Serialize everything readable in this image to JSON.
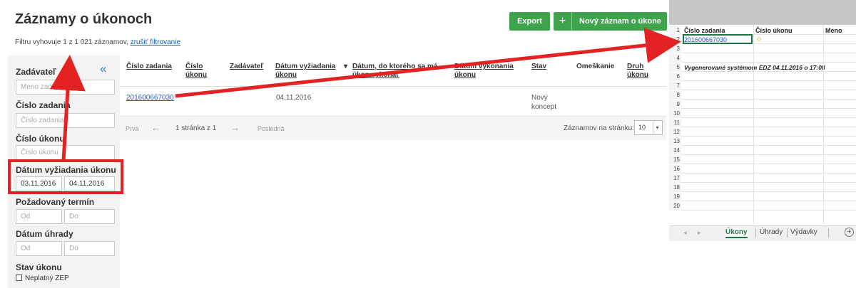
{
  "page": {
    "title": "Záznamy o úkonoch",
    "filter_prefix": "Filtru vyhovuje 1 z 1 021 záznamov, ",
    "filter_clear": "zrušiť filtrovanie"
  },
  "toolbar": {
    "export_label": "Export",
    "new_icon": "+",
    "new_label": "Nový záznam o úkone"
  },
  "sidebar": {
    "collapse_icon": "«",
    "zadavatel": {
      "label": "Zadávateľ",
      "placeholder": "Meno zadávateľa"
    },
    "cislo_zadania": {
      "label": "Číslo zadania",
      "placeholder": "Číslo zadania"
    },
    "cislo_ukonu": {
      "label": "Číslo úkonu",
      "placeholder": "Číslo úkonu"
    },
    "datum_vyziadania": {
      "label": "Dátum vyžiadania úkonu",
      "from": "03.11.2016",
      "to": "04.11.2016"
    },
    "pozadovany_termin": {
      "label": "Požadovaný termín",
      "from_placeholder": "Od",
      "to_placeholder": "Do"
    },
    "datum_uhrady": {
      "label": "Dátum úhrady",
      "from_placeholder": "Od",
      "to_placeholder": "Do"
    },
    "stav_ukonu": {
      "label": "Stav úkonu",
      "option": "Neplatný ZEP"
    }
  },
  "table": {
    "headers": {
      "cislo_zadania": "Číslo zadania",
      "cislo_ukonu_1": "Číslo",
      "cislo_ukonu_2": "úkonu",
      "zadavatel": "Zadávateľ",
      "datum_vyziadania_1": "Dátum vyžiadania",
      "datum_vyziadania_2": "úkonu",
      "sort_icon": "▾",
      "datum_do_1": "Dátum, do ktorého sa má",
      "datum_do_2": "úkon vykonať",
      "datum_vykonania_1": "Dátum vykonania",
      "datum_vykonania_2": "úkonu",
      "stav": "Stav",
      "omeskanie": "Omeškanie",
      "druh_1": "Druh",
      "druh_2": "úkonu"
    },
    "rows": [
      {
        "cislo_zadania": "201600667030",
        "datum_vyziadania": "04.11.2016",
        "stav_1": "Nový",
        "stav_2": "koncept"
      }
    ]
  },
  "pager": {
    "first": "Prvá",
    "prev_icon": "←",
    "current": "1 stránka z 1",
    "next_icon": "→",
    "last": "Posledná",
    "per_page_label": "Záznamov na stránku:",
    "per_page_value": "10",
    "caret_icon": "▾"
  },
  "excel": {
    "col_headers": [
      "Číslo zadania",
      "Číslo úkonu",
      "Meno"
    ],
    "row_numbers": [
      "1",
      "2",
      "3",
      "4",
      "5",
      "6",
      "7",
      "8",
      "9",
      "10",
      "11",
      "12",
      "13",
      "14",
      "15",
      "16",
      "17",
      "18",
      "19",
      "20"
    ],
    "cell_a2": "201600667030",
    "warning_icon": "◇",
    "cell_a5": "Vygenerované systémom EDZ 04.11.2016 o 17:08",
    "nav_prev": "◂",
    "nav_next": "▸",
    "tabs": [
      "Úkony",
      "Úhrady",
      "Výdavky"
    ],
    "add_icon": "+"
  },
  "colors": {
    "accent_green": "#3fa34d",
    "highlight_red": "#e32323",
    "link_blue": "#1a5fb4",
    "excel_green": "#217346"
  }
}
